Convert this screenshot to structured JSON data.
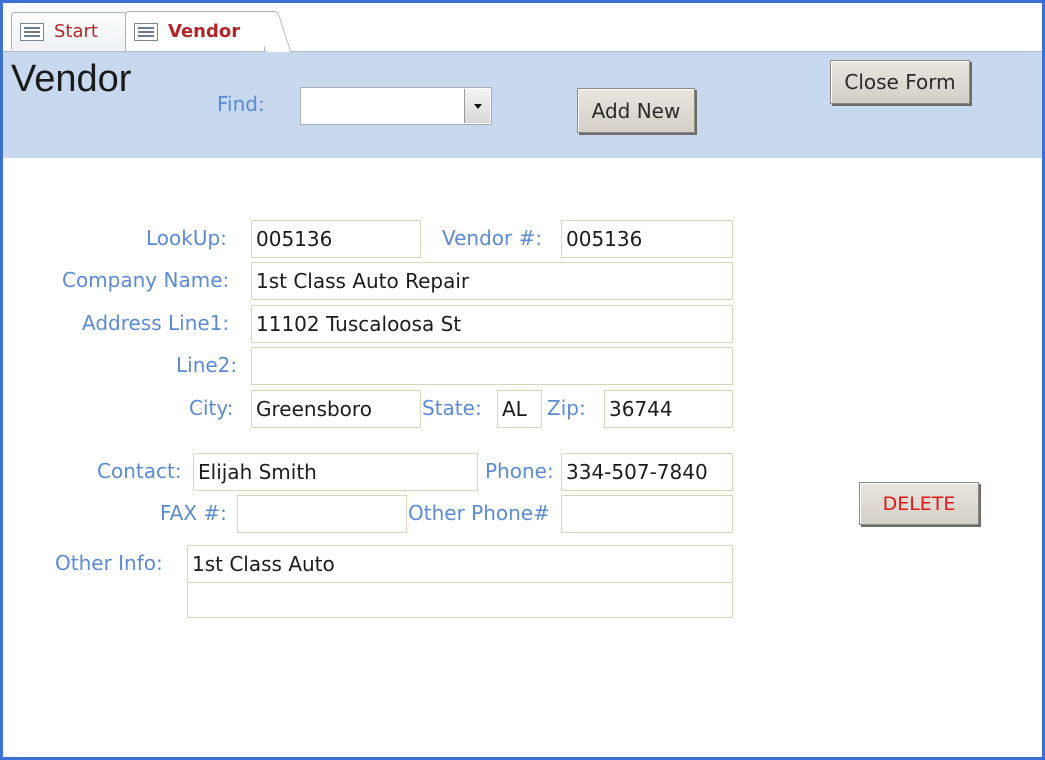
{
  "tabs": [
    {
      "label": "Start"
    },
    {
      "label": "Vendor"
    }
  ],
  "header": {
    "title": "Vendor",
    "find_label": "Find:",
    "find_value": "",
    "add_new_label": "Add New",
    "close_form_label": "Close Form"
  },
  "form": {
    "lookup_label": "LookUp:",
    "lookup_value": "005136",
    "vendor_num_label": "Vendor #:",
    "vendor_num_value": "005136",
    "company_label": "Company Name:",
    "company_value": "1st Class Auto Repair",
    "address1_label": "Address Line1:",
    "address1_value": "11102 Tuscaloosa St",
    "line2_label": "Line2:",
    "line2_value": "",
    "city_label": "City:",
    "city_value": "Greensboro",
    "state_label": "State:",
    "state_value": "AL",
    "zip_label": "Zip:",
    "zip_value": "36744",
    "contact_label": "Contact:",
    "contact_value": "Elijah Smith",
    "phone_label": "Phone:",
    "phone_value": "334-507-7840",
    "fax_label": "FAX #:",
    "fax_value": "",
    "other_phone_label": "Other Phone#",
    "other_phone_value": "",
    "other_info_label": "Other Info:",
    "other_info_value": "1st Class Auto",
    "other_info_value2": "",
    "delete_label": "DELETE"
  },
  "colors": {
    "accent_border": "#3a70d2",
    "header_bg": "#c7d8ef",
    "label_text": "#5b8bd4",
    "tab_text": "#b0262a",
    "delete_text": "#e01818"
  }
}
